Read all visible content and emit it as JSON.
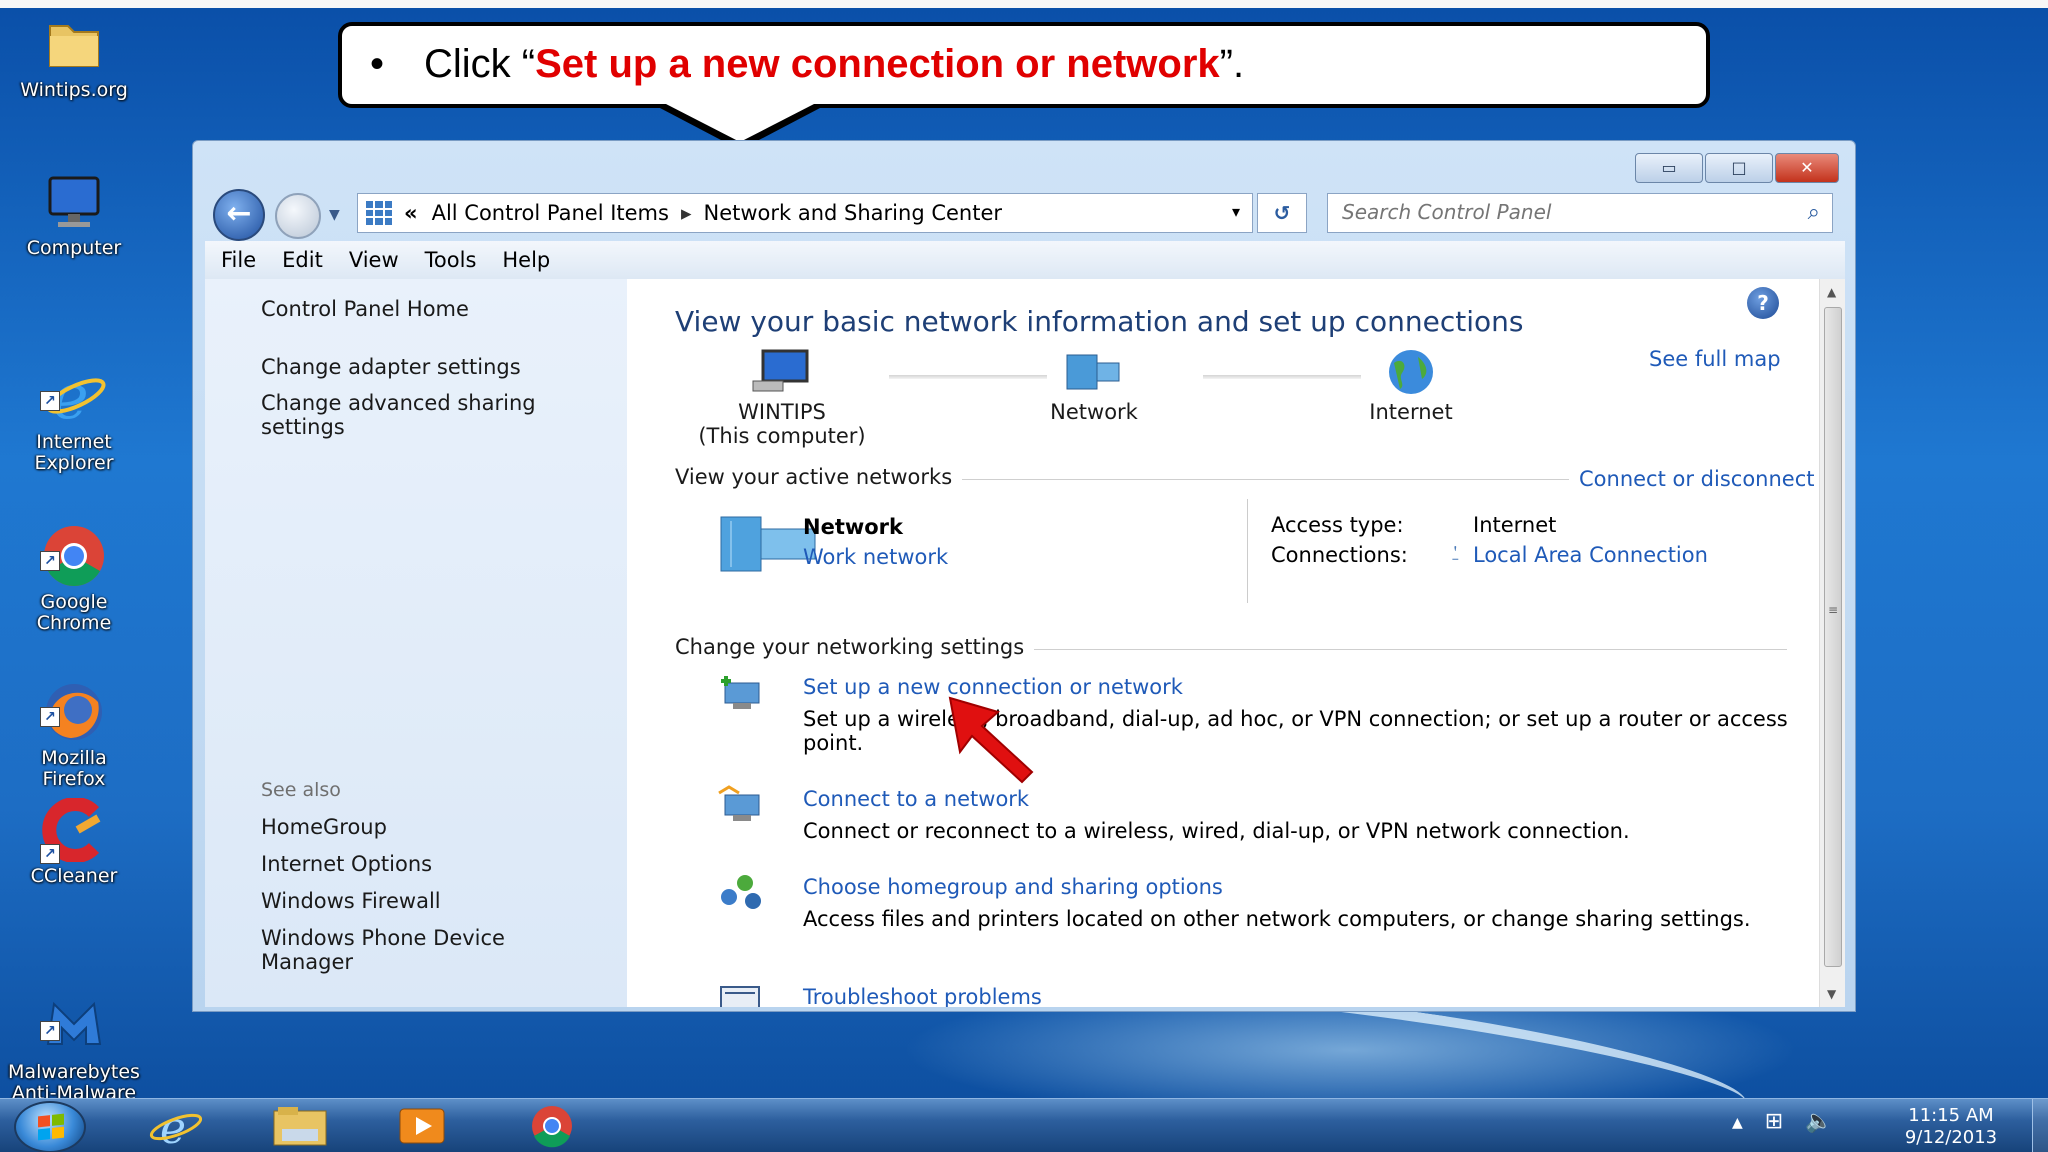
{
  "callout": {
    "bullet": "•",
    "prefix": "Click “",
    "highlight": "Set up a new connection or network",
    "suffix": "”."
  },
  "desktop_icons": [
    {
      "label": "Wintips.org",
      "icon": "folder-icon"
    },
    {
      "label": "Computer",
      "icon": "computer-icon"
    },
    {
      "label": "Internet\nExplorer",
      "icon": "internet-explorer-icon"
    },
    {
      "label": "Google\nChrome",
      "icon": "chrome-icon"
    },
    {
      "label": "Mozilla\nFirefox",
      "icon": "firefox-icon"
    },
    {
      "label": "CCleaner",
      "icon": "ccleaner-icon"
    },
    {
      "label": "Malwarebytes\nAnti-Malware",
      "icon": "malwarebytes-icon"
    }
  ],
  "window": {
    "controls": {
      "minimize": "▭",
      "maximize": "□",
      "close": "✕"
    },
    "address": {
      "prefix": "«",
      "crumbs": [
        "All Control Panel Items",
        "Network and Sharing Center"
      ],
      "separator": "▸",
      "dropdown": "▾"
    },
    "refresh": "↺",
    "search_placeholder": "Search Control Panel",
    "menu": [
      "File",
      "Edit",
      "View",
      "Tools",
      "Help"
    ]
  },
  "left_pane": {
    "links": [
      "Control Panel Home",
      "Change adapter settings",
      "Change advanced sharing settings"
    ],
    "see_also_label": "See also",
    "see_also": [
      "HomeGroup",
      "Internet Options",
      "Windows Firewall",
      "Windows Phone Device Manager"
    ]
  },
  "main": {
    "title": "View your basic network information and set up connections",
    "see_full_map": "See full map",
    "map": [
      {
        "line1": "WINTIPS",
        "line2": "(This computer)"
      },
      {
        "line1": "Network",
        "line2": ""
      },
      {
        "line1": "Internet",
        "line2": ""
      }
    ],
    "active_networks_label": "View your active networks",
    "connect_disconnect": "Connect or disconnect",
    "network_name": "Network",
    "network_type": "Work network",
    "access_type_label": "Access type:",
    "access_type_value": "Internet",
    "connections_label": "Connections:",
    "connections_value": "Local Area Connection",
    "change_settings_label": "Change your networking settings",
    "tasks": [
      {
        "link": "Set up a new connection or network",
        "desc": "Set up a wireless, broadband, dial-up, ad hoc, or VPN connection; or set up a router or access point."
      },
      {
        "link": "Connect to a network",
        "desc": "Connect or reconnect to a wireless, wired, dial-up, or VPN network connection."
      },
      {
        "link": "Choose homegroup and sharing options",
        "desc": "Access files and printers located on other network computers, or change sharing settings."
      },
      {
        "link": "Troubleshoot problems",
        "desc": ""
      }
    ]
  },
  "taskbar": {
    "tray_arrow": "▲",
    "time": "11:15 AM",
    "date": "9/12/2013"
  },
  "colors": {
    "accent_red": "#e00000",
    "link_blue": "#1f5ab8",
    "title_blue": "#1e3f76"
  }
}
